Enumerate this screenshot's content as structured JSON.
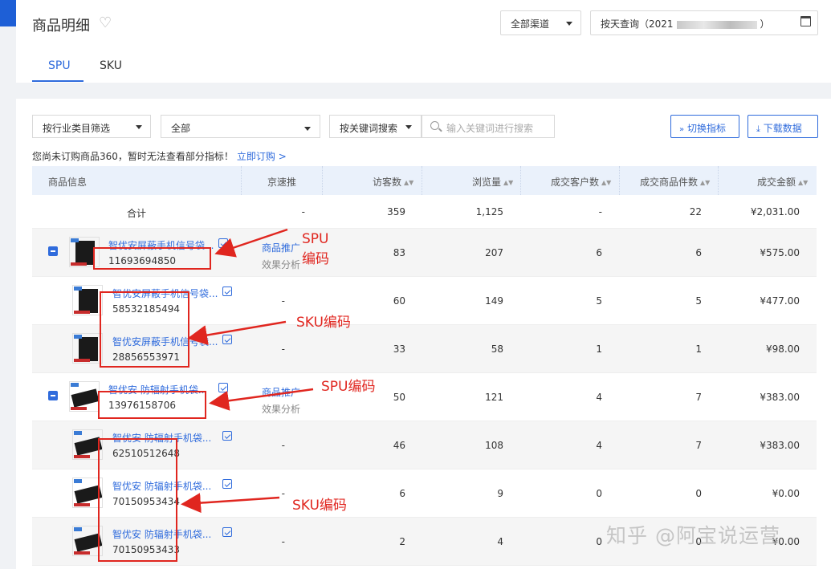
{
  "header": {
    "title": "商品明细",
    "channel": "全部渠道",
    "date_prefix": "按天查询（2021",
    "date_suffix": "）",
    "tabs": [
      "SPU",
      "SKU"
    ]
  },
  "filters": {
    "industry": "按行业类目筛选",
    "category": "全部",
    "keyword_mode": "按关键词搜索",
    "search_placeholder": "输入关键词进行搜索",
    "switch_metric": "切换指标",
    "download": "下载数据"
  },
  "notice": {
    "text": "您尚未订购商品360，暂时无法查看部分指标！",
    "link": "立即订购 >"
  },
  "table": {
    "headers": [
      "商品信息",
      "京速推",
      "访客数",
      "浏览量",
      "成交客户数",
      "成交商品件数",
      "成交金额"
    ],
    "total": {
      "label": "合计",
      "jst": "-",
      "visitors": "359",
      "views": "1,125",
      "customers": "-",
      "items": "22",
      "amount": "¥2,031.00"
    },
    "rows": [
      {
        "type": "spu",
        "name": "智优安屏蔽手机信号袋...",
        "code": "11693694850",
        "promo1": "商品推广",
        "promo2": "效果分析",
        "visitors": "83",
        "views": "207",
        "customers": "6",
        "items": "6",
        "amount": "¥575.00"
      },
      {
        "type": "sku",
        "name": "智优安屏蔽手机信号袋...",
        "code": "58532185494",
        "jst": "-",
        "visitors": "60",
        "views": "149",
        "customers": "5",
        "items": "5",
        "amount": "¥477.00"
      },
      {
        "type": "sku",
        "name": "智优安屏蔽手机信号袋...",
        "code": "28856553971",
        "jst": "-",
        "visitors": "33",
        "views": "58",
        "customers": "1",
        "items": "1",
        "amount": "¥98.00"
      },
      {
        "type": "spu",
        "name": "智优安 防辐射手机袋...",
        "code": "13976158706",
        "promo1": "商品推广",
        "promo2": "效果分析",
        "visitors": "50",
        "views": "121",
        "customers": "4",
        "items": "7",
        "amount": "¥383.00"
      },
      {
        "type": "sku",
        "name": "智优安 防辐射手机袋...",
        "code": "62510512648",
        "jst": "-",
        "visitors": "46",
        "views": "108",
        "customers": "4",
        "items": "7",
        "amount": "¥383.00"
      },
      {
        "type": "sku",
        "name": "智优安 防辐射手机袋...",
        "code": "70150953434",
        "jst": "-",
        "visitors": "6",
        "views": "9",
        "customers": "0",
        "items": "0",
        "amount": "¥0.00"
      },
      {
        "type": "sku",
        "name": "智优安 防辐射手机袋...",
        "code": "70150953433",
        "jst": "-",
        "visitors": "2",
        "views": "4",
        "customers": "0",
        "items": "0",
        "amount": "¥0.00"
      }
    ]
  },
  "annotations": {
    "spu1_line1": "SPU",
    "spu1_line2": "编码",
    "sku1": "SKU编码",
    "spu2": "SPU编码",
    "sku2": "SKU编码",
    "color": "#e0261f"
  },
  "watermark": "知乎 @阿宝说运营"
}
